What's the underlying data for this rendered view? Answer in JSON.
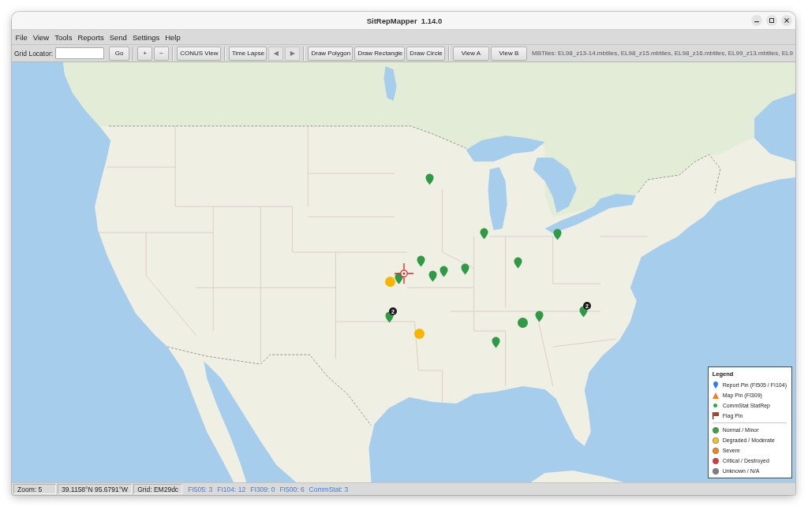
{
  "window": {
    "title": "SitRepMapper  1.14.0"
  },
  "menu": [
    "File",
    "View",
    "Tools",
    "Reports",
    "Send",
    "Settings",
    "Help"
  ],
  "toolbar": {
    "grid_locator": {
      "label": "Grid Locator:",
      "button": {
        "label": "Go",
        "disabled": false
      }
    },
    "groups": [
      [
        {
          "label": "+",
          "disabled": false
        },
        {
          "label": "−",
          "disabled": false
        }
      ],
      [
        {
          "label": "CONUS View",
          "disabled": false
        }
      ],
      [
        {
          "label": "Time Lapse",
          "disabled": false
        },
        {
          "label": "◀",
          "disabled": true
        },
        {
          "label": "▶",
          "disabled": true
        }
      ],
      [
        {
          "label": "Draw Polygon",
          "disabled": false
        },
        {
          "label": "Draw Rectangle",
          "disabled": false
        },
        {
          "label": "Draw Circle",
          "disabled": false
        }
      ],
      [
        {
          "label": "View A",
          "disabled": false
        },
        {
          "label": "View B",
          "disabled": false
        }
      ]
    ],
    "tiles_info": "MBTiles: EL98_z13-14.mbtiles, EL98_z15.mbtiles, EL98_z16.mbtiles, EL99_z13.mbtiles, EL9"
  },
  "map": {
    "pins": [
      {
        "kind": "marker",
        "color": "#2f9a45"
      },
      {
        "kind": "marker",
        "color": "#2f9a45"
      },
      {
        "kind": "marker",
        "color": "#2f9a45"
      },
      {
        "kind": "marker",
        "color": "#2f9a45"
      },
      {
        "kind": "marker",
        "color": "#2f9a45"
      },
      {
        "kind": "marker",
        "color": "#2f9a45"
      },
      {
        "kind": "marker",
        "color": "#2f9a45"
      },
      {
        "kind": "marker",
        "color": "#2f9a45"
      },
      {
        "kind": "marker",
        "color": "#2f9a45"
      },
      {
        "kind": "circle",
        "color": "#f7b500"
      },
      {
        "kind": "cluster",
        "color": "#2f9a45",
        "count": "2"
      },
      {
        "kind": "cluster",
        "color": "#2f9a45",
        "count": "2"
      },
      {
        "kind": "marker",
        "color": "#2f9a45"
      },
      {
        "kind": "circle",
        "color": "#2f9a45"
      },
      {
        "kind": "circle",
        "color": "#f7b500"
      },
      {
        "kind": "marker",
        "color": "#2f9a45"
      }
    ],
    "legend": {
      "title": "Legend",
      "pin_types": [
        {
          "kind": "report-pin",
          "label": "Report Pin (FI505 / FI104)"
        },
        {
          "kind": "map-pin",
          "label": "Map Pin (FI309)"
        },
        {
          "kind": "commstat",
          "label": "CommStat StatRep"
        },
        {
          "kind": "flag",
          "label": "Flag Pin"
        }
      ],
      "statuses": [
        {
          "label": "Normal / Minor",
          "color": "#36a346"
        },
        {
          "label": "Degraded / Moderate",
          "color": "#f6c21c"
        },
        {
          "label": "Severe",
          "color": "#f5841f"
        },
        {
          "label": "Critical / Destroyed",
          "color": "#dc3545"
        },
        {
          "label": "Unknown / N/A",
          "color": "#808080"
        }
      ]
    }
  },
  "status_bar": {
    "zoom": "Zoom: 5",
    "position": "39.1158°N 95.6791°W",
    "grid": "Grid: EM29dc",
    "counts": [
      "FI505: 3",
      "FI104: 12",
      "FI309: 0",
      "FI500: 6",
      "CommStat: 3"
    ]
  }
}
